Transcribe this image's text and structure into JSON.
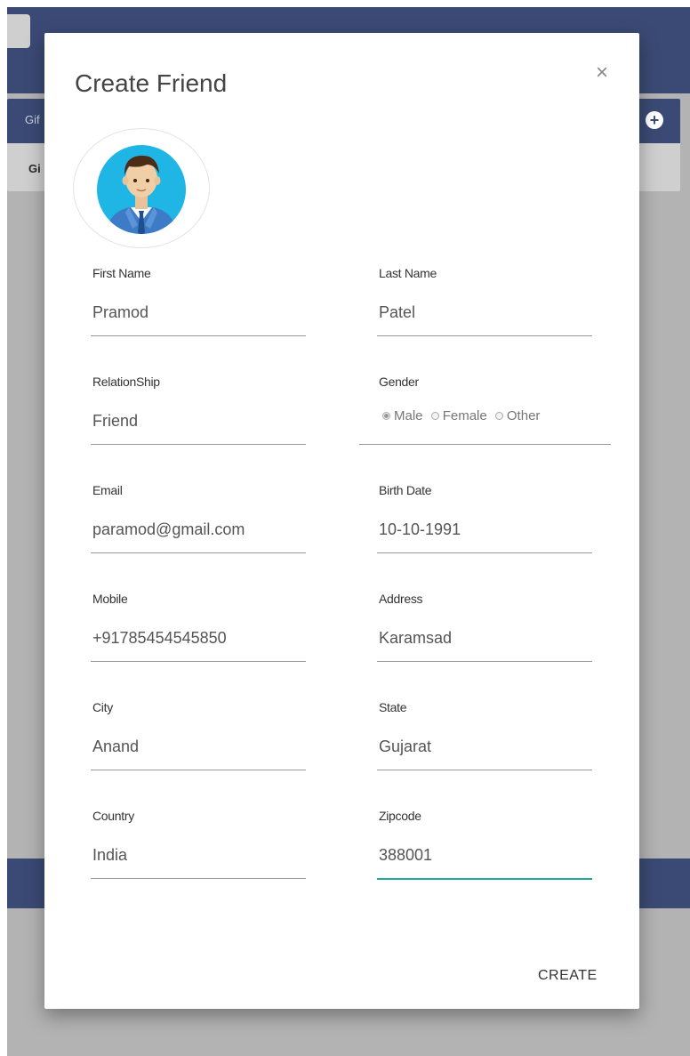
{
  "background": {
    "card_title": "Gif",
    "card_subtitle": "Gi"
  },
  "modal": {
    "title": "Create Friend",
    "close_label": "×",
    "avatar_icon": "user-avatar-icon",
    "create_label": "CREATE"
  },
  "form": {
    "first_name": {
      "label": "First Name",
      "value": "Pramod"
    },
    "last_name": {
      "label": "Last Name",
      "value": "Patel"
    },
    "relationship": {
      "label": "RelationShip",
      "value": "Friend"
    },
    "gender": {
      "label": "Gender",
      "options": [
        "Male",
        "Female",
        "Other"
      ],
      "selected": "Male"
    },
    "email": {
      "label": "Email",
      "value": "paramod@gmail.com"
    },
    "birth_date": {
      "label": "Birth Date",
      "value": "10-10-1991"
    },
    "mobile": {
      "label": "Mobile",
      "value": "+91785454545850"
    },
    "address": {
      "label": "Address",
      "value": "Karamsad"
    },
    "city": {
      "label": "City",
      "value": "Anand"
    },
    "state": {
      "label": "State",
      "value": "Gujarat"
    },
    "country": {
      "label": "Country",
      "value": "India"
    },
    "zipcode": {
      "label": "Zipcode",
      "value": "388001"
    }
  },
  "colors": {
    "header_bg": "#3b4a75",
    "overlay_bg": "#b3b3b3",
    "active_underline": "#26a69a"
  }
}
